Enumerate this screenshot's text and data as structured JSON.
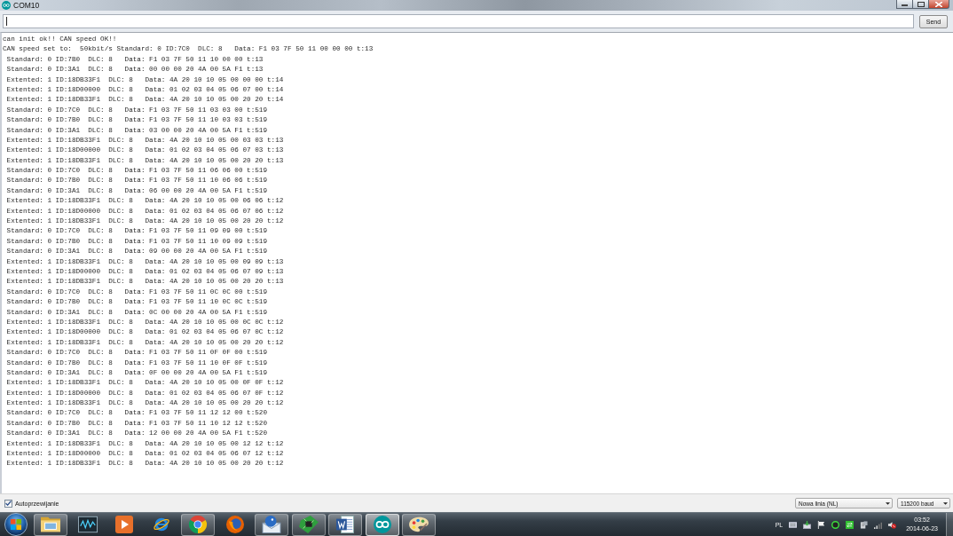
{
  "window": {
    "title": "COM10"
  },
  "input": {
    "focused": true
  },
  "send_button": "Send",
  "output": {
    "lines": [
      "can init ok!! CAN speed OK!!",
      "CAN speed set to:  50kbit/s Standard: 0 ID:7C0  DLC: 8   Data: F1 03 7F 50 11 00 00 00 t:13",
      " Standard: 0 ID:7B0  DLC: 8   Data: F1 03 7F 50 11 10 00 00 t:13",
      " Standard: 0 ID:3A1  DLC: 8   Data: 00 00 00 20 4A 00 5A F1 t:13",
      " Extented: 1 ID:18DB33F1  DLC: 8   Data: 4A 20 10 10 05 00 00 00 t:14",
      " Extented: 1 ID:18D00000  DLC: 8   Data: 01 02 03 04 05 06 07 00 t:14",
      " Extented: 1 ID:18DB33F1  DLC: 8   Data: 4A 20 10 10 05 00 20 20 t:14",
      " Standard: 0 ID:7C0  DLC: 8   Data: F1 03 7F 50 11 03 03 00 t:519",
      " Standard: 0 ID:7B0  DLC: 8   Data: F1 03 7F 50 11 10 03 03 t:519",
      " Standard: 0 ID:3A1  DLC: 8   Data: 03 00 00 20 4A 00 5A F1 t:519",
      " Extented: 1 ID:18DB33F1  DLC: 8   Data: 4A 20 10 10 05 00 03 03 t:13",
      " Extented: 1 ID:18D00000  DLC: 8   Data: 01 02 03 04 05 06 07 03 t:13",
      " Extented: 1 ID:18DB33F1  DLC: 8   Data: 4A 20 10 10 05 00 20 20 t:13",
      " Standard: 0 ID:7C0  DLC: 8   Data: F1 03 7F 50 11 06 06 00 t:519",
      " Standard: 0 ID:7B0  DLC: 8   Data: F1 03 7F 50 11 10 06 06 t:519",
      " Standard: 0 ID:3A1  DLC: 8   Data: 06 00 00 20 4A 00 5A F1 t:519",
      " Extented: 1 ID:18DB33F1  DLC: 8   Data: 4A 20 10 10 05 00 06 06 t:12",
      " Extented: 1 ID:18D00000  DLC: 8   Data: 01 02 03 04 05 06 07 06 t:12",
      " Extented: 1 ID:18DB33F1  DLC: 8   Data: 4A 20 10 10 05 00 20 20 t:12",
      " Standard: 0 ID:7C0  DLC: 8   Data: F1 03 7F 50 11 09 09 00 t:519",
      " Standard: 0 ID:7B0  DLC: 8   Data: F1 03 7F 50 11 10 09 09 t:519",
      " Standard: 0 ID:3A1  DLC: 8   Data: 09 00 00 20 4A 00 5A F1 t:519",
      " Extented: 1 ID:18DB33F1  DLC: 8   Data: 4A 20 10 10 05 00 09 09 t:13",
      " Extented: 1 ID:18D00000  DLC: 8   Data: 01 02 03 04 05 06 07 09 t:13",
      " Extented: 1 ID:18DB33F1  DLC: 8   Data: 4A 20 10 10 05 00 20 20 t:13",
      " Standard: 0 ID:7C0  DLC: 8   Data: F1 03 7F 50 11 0C 0C 00 t:519",
      " Standard: 0 ID:7B0  DLC: 8   Data: F1 03 7F 50 11 10 0C 0C t:519",
      " Standard: 0 ID:3A1  DLC: 8   Data: 0C 00 00 20 4A 00 5A F1 t:519",
      " Extented: 1 ID:18DB33F1  DLC: 8   Data: 4A 20 10 10 05 00 0C 0C t:12",
      " Extented: 1 ID:18D00000  DLC: 8   Data: 01 02 03 04 05 06 07 0C t:12",
      " Extented: 1 ID:18DB33F1  DLC: 8   Data: 4A 20 10 10 05 00 20 20 t:12",
      " Standard: 0 ID:7C0  DLC: 8   Data: F1 03 7F 50 11 0F 0F 00 t:519",
      " Standard: 0 ID:7B0  DLC: 8   Data: F1 03 7F 50 11 10 0F 0F t:519",
      " Standard: 0 ID:3A1  DLC: 8   Data: 0F 00 00 20 4A 00 5A F1 t:519",
      " Extented: 1 ID:18DB33F1  DLC: 8   Data: 4A 20 10 10 05 00 0F 0F t:12",
      " Extented: 1 ID:18D00000  DLC: 8   Data: 01 02 03 04 05 06 07 0F t:12",
      " Extented: 1 ID:18DB33F1  DLC: 8   Data: 4A 20 10 10 05 00 20 20 t:12",
      " Standard: 0 ID:7C0  DLC: 8   Data: F1 03 7F 50 11 12 12 00 t:520",
      " Standard: 0 ID:7B0  DLC: 8   Data: F1 03 7F 50 11 10 12 12 t:520",
      " Standard: 0 ID:3A1  DLC: 8   Data: 12 00 00 20 4A 00 5A F1 t:520",
      " Extented: 1 ID:18DB33F1  DLC: 8   Data: 4A 20 10 10 05 00 12 12 t:12",
      " Extented: 1 ID:18D00000  DLC: 8   Data: 01 02 03 04 05 06 07 12 t:12",
      " Extented: 1 ID:18DB33F1  DLC: 8   Data: 4A 20 10 10 05 00 20 20 t:12"
    ]
  },
  "footer": {
    "autoscroll": {
      "label": "Autoprzewijanie",
      "checked": true
    },
    "line_ending": "Nowa linia (NL)",
    "baud": "115200 baud"
  },
  "taskbar": {
    "items": [
      {
        "kind": "folder",
        "running": true,
        "selected": false
      },
      {
        "kind": "waveform",
        "running": false,
        "selected": false
      },
      {
        "kind": "play",
        "running": false,
        "selected": false
      },
      {
        "kind": "ring",
        "running": false,
        "selected": false
      },
      {
        "kind": "wheel",
        "running": true,
        "selected": false
      },
      {
        "kind": "globe",
        "running": false,
        "selected": false
      },
      {
        "kind": "envelope",
        "running": true,
        "selected": false
      },
      {
        "kind": "chip",
        "running": true,
        "selected": false
      },
      {
        "kind": "document",
        "running": true,
        "selected": false
      },
      {
        "kind": "infinity",
        "running": true,
        "selected": true
      },
      {
        "kind": "palette",
        "running": true,
        "selected": false
      }
    ],
    "tray": {
      "language": "PL",
      "muted": true,
      "time": "03:52",
      "date": "2014-06-23"
    }
  }
}
